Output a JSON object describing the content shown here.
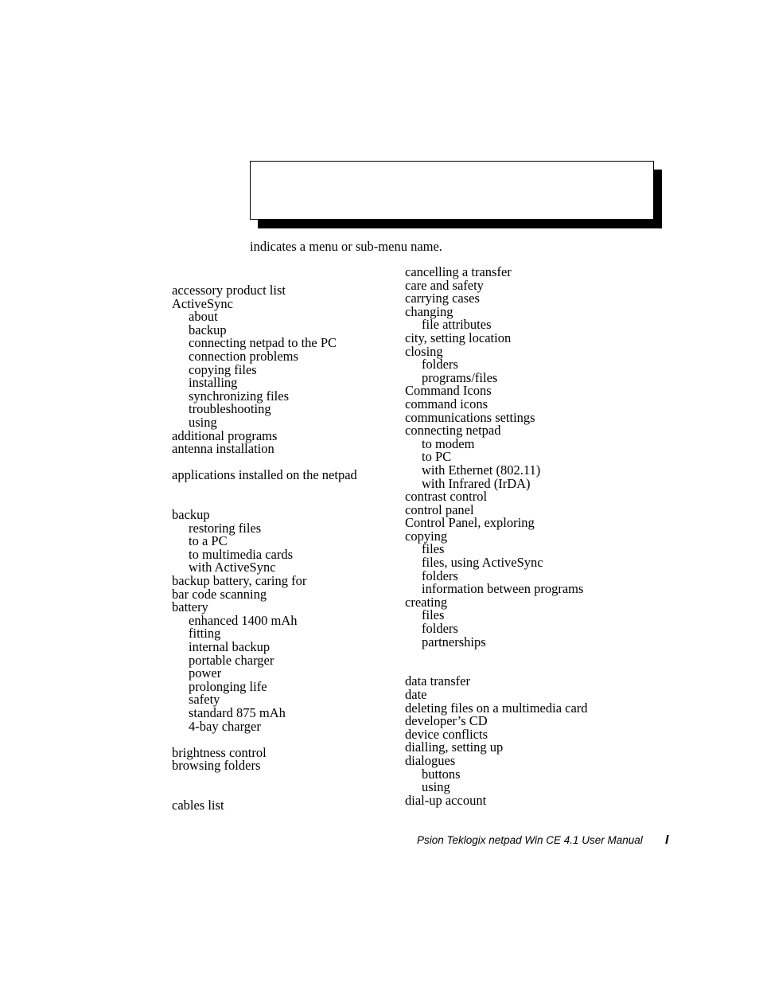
{
  "document": {
    "type": "index",
    "legend_caption": "indicates a menu or sub-menu name."
  },
  "legend_figure": {
    "name": "menu-name-legend-graphic",
    "content": ""
  },
  "index": {
    "left_column": [
      {
        "text": "accessory product list",
        "level": 1
      },
      {
        "text": "ActiveSync",
        "level": 1
      },
      {
        "text": "about",
        "level": 2
      },
      {
        "text": "backup",
        "level": 2
      },
      {
        "text": "connecting netpad to the PC",
        "level": 2
      },
      {
        "text": "connection problems",
        "level": 2
      },
      {
        "text": "copying files",
        "level": 2
      },
      {
        "text": "installing",
        "level": 2
      },
      {
        "text": "synchronizing files",
        "level": 2
      },
      {
        "text": "troubleshooting",
        "level": 2
      },
      {
        "text": "using",
        "level": 2
      },
      {
        "text": "additional programs",
        "level": 1
      },
      {
        "text": "antenna installation",
        "level": 1
      },
      {
        "text": "",
        "level": 0
      },
      {
        "text": "applications installed on the netpad",
        "level": 1
      },
      {
        "text": "",
        "level": 0
      },
      {
        "text": "",
        "level": 0
      },
      {
        "text": "backup",
        "level": 1
      },
      {
        "text": "restoring files",
        "level": 2
      },
      {
        "text": "to a PC",
        "level": 2
      },
      {
        "text": "to multimedia cards",
        "level": 2
      },
      {
        "text": "with ActiveSync",
        "level": 2
      },
      {
        "text": "backup battery, caring for",
        "level": 1
      },
      {
        "text": "bar code scanning",
        "level": 1
      },
      {
        "text": "battery",
        "level": 1
      },
      {
        "text": "enhanced 1400 mAh",
        "level": 2
      },
      {
        "text": "fitting",
        "level": 2
      },
      {
        "text": "internal backup",
        "level": 2
      },
      {
        "text": "portable charger",
        "level": 2
      },
      {
        "text": "power",
        "level": 2
      },
      {
        "text": "prolonging life",
        "level": 2
      },
      {
        "text": "safety",
        "level": 2
      },
      {
        "text": "standard 875 mAh",
        "level": 2
      },
      {
        "text": "4-bay charger",
        "level": 2
      },
      {
        "text": "",
        "level": 0
      },
      {
        "text": "brightness control",
        "level": 1
      },
      {
        "text": "browsing folders",
        "level": 1
      },
      {
        "text": "",
        "level": 0
      },
      {
        "text": "",
        "level": 0
      },
      {
        "text": "cables list",
        "level": 1
      }
    ],
    "right_column": [
      {
        "text": "cancelling a transfer",
        "level": 1
      },
      {
        "text": "care and safety",
        "level": 1
      },
      {
        "text": "carrying cases",
        "level": 1
      },
      {
        "text": "changing",
        "level": 1
      },
      {
        "text": "file attributes",
        "level": 2
      },
      {
        "text": "city, setting location",
        "level": 1
      },
      {
        "text": "closing",
        "level": 1
      },
      {
        "text": "folders",
        "level": 2
      },
      {
        "text": "programs/files",
        "level": 2
      },
      {
        "text": "Command Icons",
        "level": 1
      },
      {
        "text": "command icons",
        "level": 1
      },
      {
        "text": "communications settings",
        "level": 1
      },
      {
        "text": "connecting netpad",
        "level": 1
      },
      {
        "text": "to modem",
        "level": 2
      },
      {
        "text": "to PC",
        "level": 2
      },
      {
        "text": "with Ethernet (802.11)",
        "level": 2
      },
      {
        "text": "with Infrared (IrDA)",
        "level": 2
      },
      {
        "text": "contrast control",
        "level": 1
      },
      {
        "text": "control panel",
        "level": 1
      },
      {
        "text": "Control Panel, exploring",
        "level": 1
      },
      {
        "text": "copying",
        "level": 1
      },
      {
        "text": "files",
        "level": 2
      },
      {
        "text": "files, using ActiveSync",
        "level": 2
      },
      {
        "text": "folders",
        "level": 2
      },
      {
        "text": "information between programs",
        "level": 2
      },
      {
        "text": "creating",
        "level": 1
      },
      {
        "text": "files",
        "level": 2
      },
      {
        "text": "folders",
        "level": 2
      },
      {
        "text": "partnerships",
        "level": 2
      },
      {
        "text": "",
        "level": 0
      },
      {
        "text": "",
        "level": 0
      },
      {
        "text": "data transfer",
        "level": 1
      },
      {
        "text": "date",
        "level": 1
      },
      {
        "text": "deleting files on a multimedia card",
        "level": 1
      },
      {
        "text": "developer’s CD",
        "level": 1
      },
      {
        "text": "device conflicts",
        "level": 1
      },
      {
        "text": "dialling, setting up",
        "level": 1
      },
      {
        "text": "dialogues",
        "level": 1
      },
      {
        "text": "buttons",
        "level": 2
      },
      {
        "text": "using",
        "level": 2
      },
      {
        "text": "dial-up account",
        "level": 1
      }
    ]
  },
  "footer": {
    "title": "Psion Teklogix netpad Win CE 4.1 User Manual",
    "page_number": "I"
  },
  "colors": {
    "text": "#000000",
    "background": "#ffffff",
    "shadow": "#000000"
  }
}
